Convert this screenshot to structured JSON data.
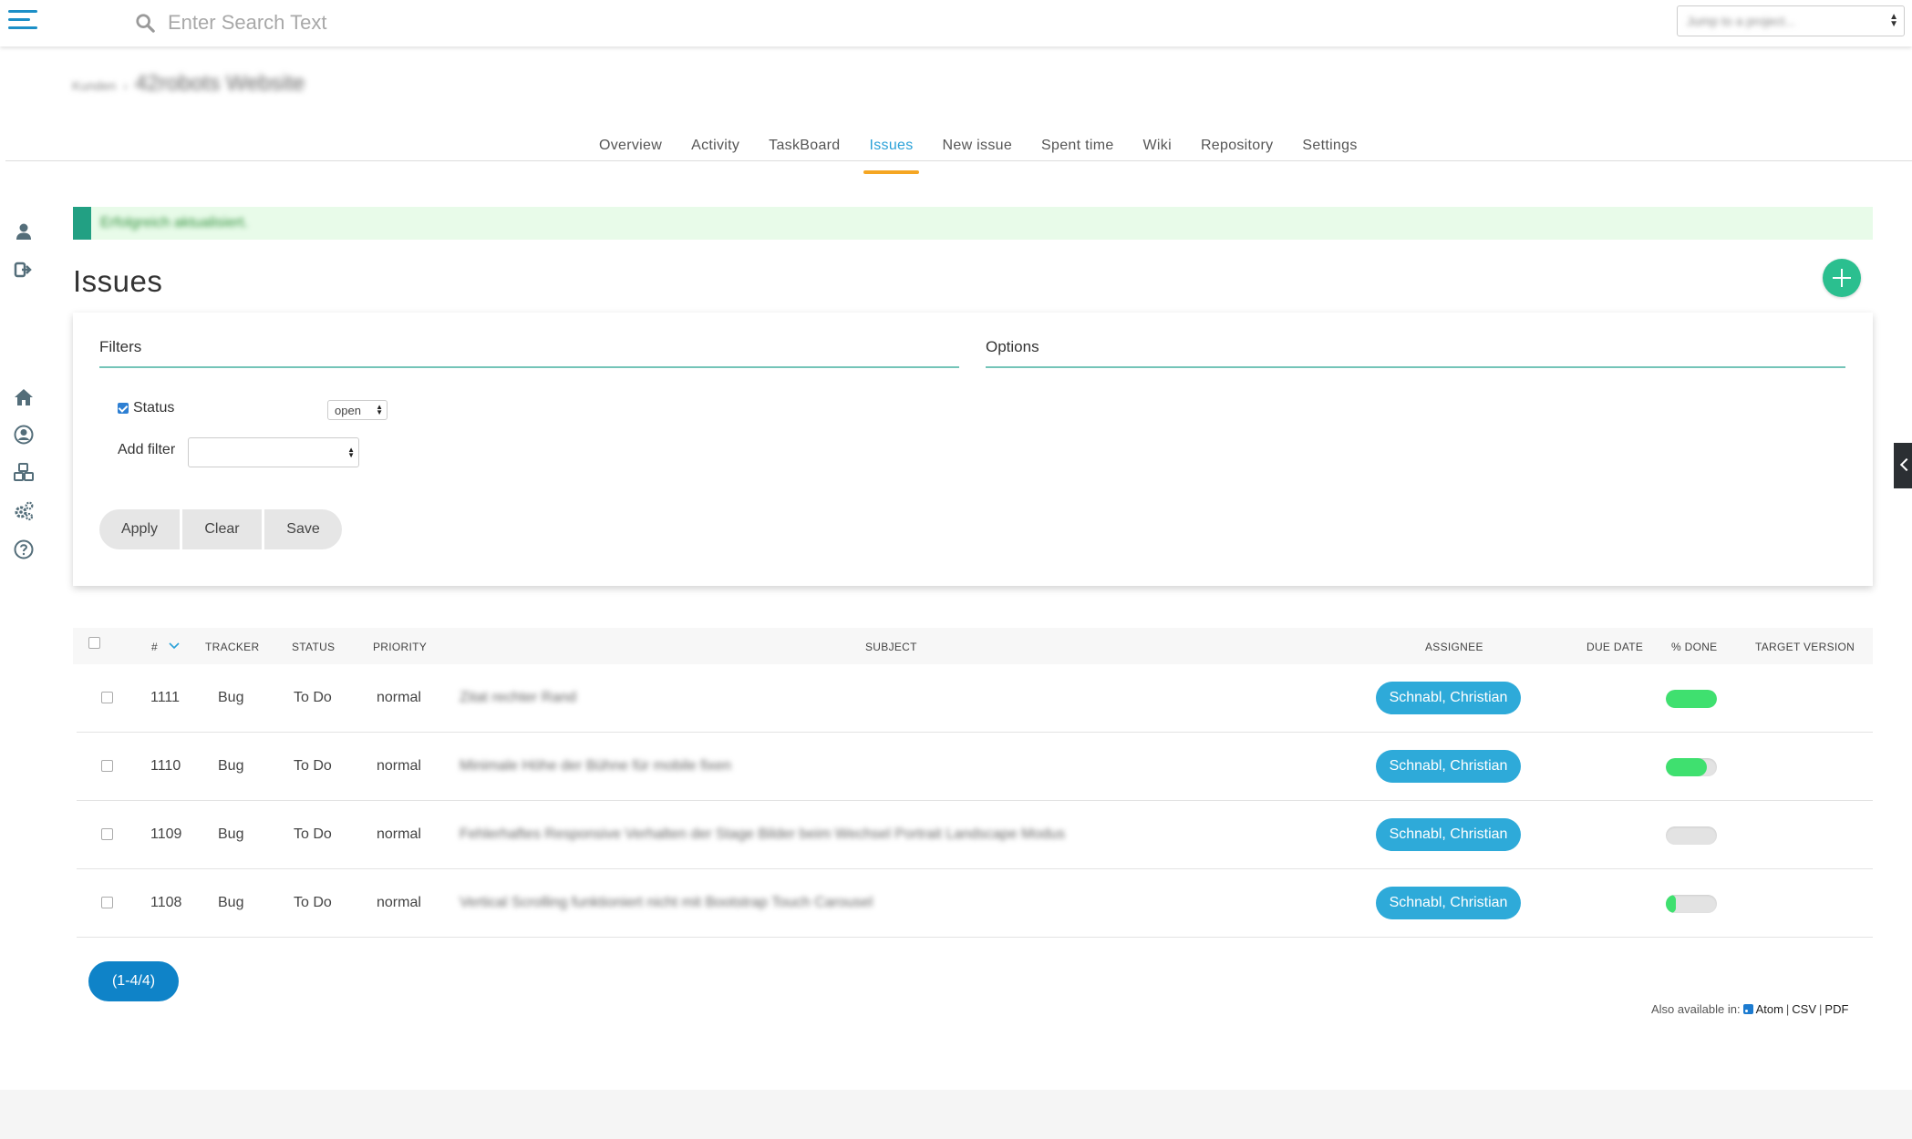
{
  "search": {
    "placeholder": "Enter Search Text"
  },
  "project_selector": {
    "value": "Jump to a project..."
  },
  "breadcrumb": {
    "parent": "Kunden",
    "title": "42robots Website"
  },
  "tabs": [
    {
      "label": "Overview"
    },
    {
      "label": "Activity"
    },
    {
      "label": "TaskBoard"
    },
    {
      "label": "Issues",
      "active": true
    },
    {
      "label": "New issue"
    },
    {
      "label": "Spent time"
    },
    {
      "label": "Wiki"
    },
    {
      "label": "Repository"
    },
    {
      "label": "Settings"
    }
  ],
  "flash": {
    "message": "Erfolgreich aktualisiert."
  },
  "page": {
    "title": "Issues"
  },
  "filters": {
    "heading": "Filters",
    "options_heading": "Options",
    "status_label": "Status",
    "status_checked": true,
    "status_value": "open",
    "add_filter_label": "Add filter",
    "add_filter_value": "",
    "apply": "Apply",
    "clear": "Clear",
    "save": "Save"
  },
  "table": {
    "columns": {
      "id": "#",
      "tracker": "TRACKER",
      "status": "STATUS",
      "priority": "PRIORITY",
      "subject": "SUBJECT",
      "assignee": "ASSIGNEE",
      "due_date": "DUE DATE",
      "done": "% DONE",
      "target_version": "TARGET VERSION"
    },
    "rows": [
      {
        "id": "1111",
        "tracker": "Bug",
        "status": "To Do",
        "priority": "normal",
        "subject": "Zitat rechter Rand",
        "assignee": "Schnabl, Christian",
        "done": 100
      },
      {
        "id": "1110",
        "tracker": "Bug",
        "status": "To Do",
        "priority": "normal",
        "subject": "Minimale Höhe der Bühne für mobile fixen",
        "assignee": "Schnabl, Christian",
        "done": 80
      },
      {
        "id": "1109",
        "tracker": "Bug",
        "status": "To Do",
        "priority": "normal",
        "subject": "Fehlerhaftes Responsive Verhalten der Stage Bilder beim Wechsel Portrait Landscape Modus",
        "assignee": "Schnabl, Christian",
        "done": 0
      },
      {
        "id": "1108",
        "tracker": "Bug",
        "status": "To Do",
        "priority": "normal",
        "subject": "Vertical Scrolling funktioniert nicht mit Bootstrap Touch Carousel",
        "assignee": "Schnabl, Christian",
        "done": 20
      }
    ]
  },
  "pagination": {
    "label": "(1-4/4)"
  },
  "export": {
    "prefix": "Also available in:",
    "atom": "Atom",
    "csv": "CSV",
    "pdf": "PDF",
    "sep": "|"
  },
  "colors": {
    "accent": "#2aa1d8",
    "tab_underline": "#f5a623",
    "add_button": "#2bbf8f",
    "progress": "#3fe06f",
    "assignee_badge": "#2eaad9",
    "pagination": "#0f83c8"
  }
}
